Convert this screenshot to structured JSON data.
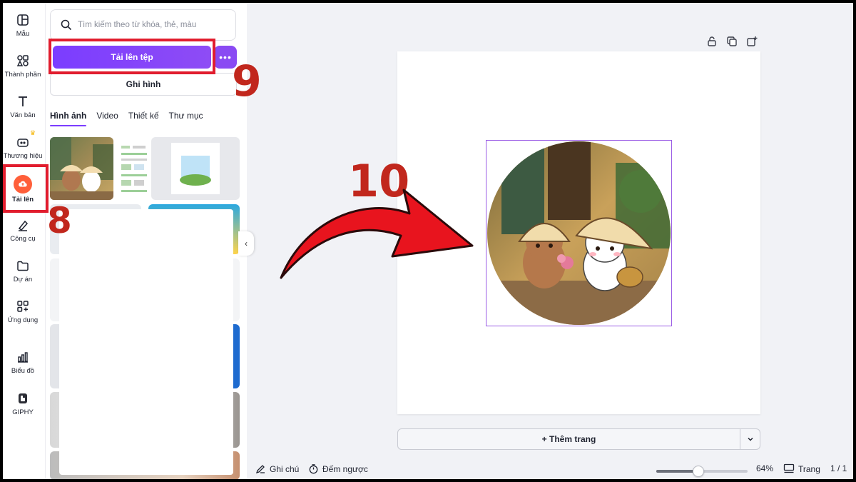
{
  "nav": {
    "items": [
      {
        "label": "Mẫu",
        "icon": "template-icon"
      },
      {
        "label": "Thành phần",
        "icon": "elements-icon"
      },
      {
        "label": "Văn bản",
        "icon": "text-icon"
      },
      {
        "label": "Thương hiệu",
        "icon": "brand-icon"
      },
      {
        "label": "Tải lên",
        "icon": "upload-cloud-icon",
        "active": true
      },
      {
        "label": "Công cụ",
        "icon": "pen-tool-icon"
      },
      {
        "label": "Dự án",
        "icon": "folder-icon"
      },
      {
        "label": "Ứng dụng",
        "icon": "apps-icon"
      },
      {
        "label": "Biểu đồ",
        "icon": "bar-chart-icon"
      },
      {
        "label": "GIPHY",
        "icon": "giphy-icon"
      }
    ]
  },
  "panel": {
    "search_placeholder": "Tìm kiếm theo từ khóa, thẻ, màu",
    "upload_label": "Tải lên tệp",
    "more_label": "•••",
    "record_label": "Ghi hình",
    "tabs": [
      "Hình ảnh",
      "Video",
      "Thiết kế",
      "Thư mục"
    ],
    "active_tab": "Hình ảnh"
  },
  "canvas": {
    "add_page_label": "+ Thêm trang"
  },
  "bottombar": {
    "notes_label": "Ghi chú",
    "timer_label": "Đếm ngược",
    "zoom_level": "64%",
    "zoom_fraction": 0.46,
    "pages_label": "Trang",
    "page_counter": "1 / 1"
  },
  "annotations": {
    "step8": "8",
    "step9": "9",
    "step10": "10"
  },
  "colors": {
    "accent": "#7b3dff",
    "upload_active": "#ff5f3a",
    "annotation_red": "#e11d2e",
    "number_red": "#c1271d"
  }
}
